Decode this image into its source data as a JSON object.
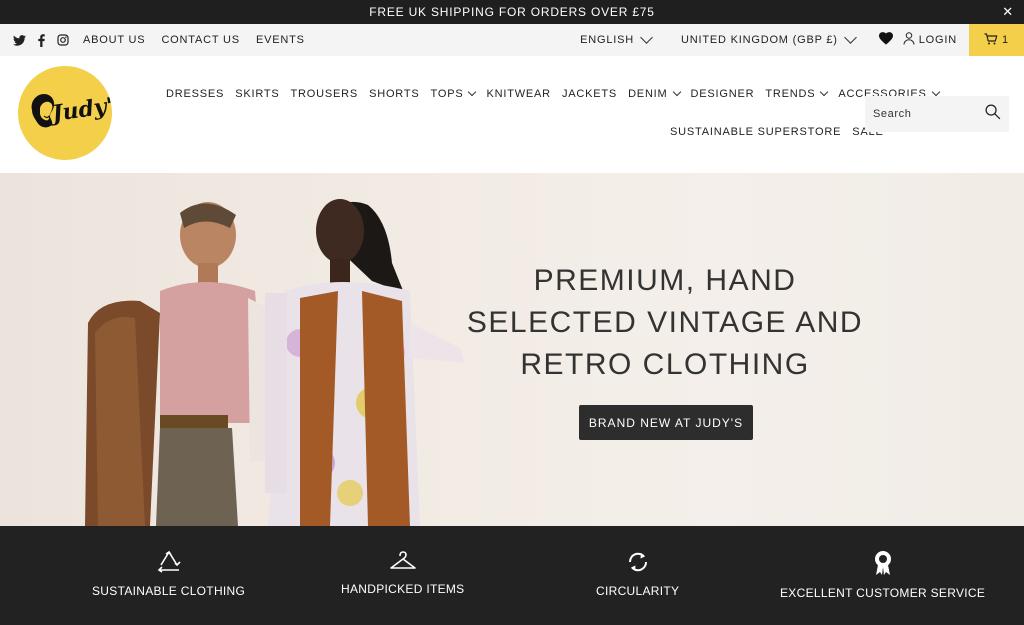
{
  "announcement": {
    "text": "FREE UK SHIPPING FOR ORDERS OVER £75",
    "close_icon": "✕"
  },
  "utility": {
    "social_icons": [
      "twitter-icon",
      "facebook-icon",
      "instagram-icon"
    ],
    "links": [
      "ABOUT US",
      "CONTACT US",
      "EVENTS"
    ],
    "language": "ENGLISH",
    "country": "UNITED KINGDOM (GBP £)",
    "login": "LOGIN",
    "cart_count": "1"
  },
  "logo": {
    "text": "Judy's"
  },
  "nav": {
    "row1": [
      {
        "label": "DRESSES",
        "dropdown": false
      },
      {
        "label": "SKIRTS",
        "dropdown": false
      },
      {
        "label": "TROUSERS",
        "dropdown": false
      },
      {
        "label": "SHORTS",
        "dropdown": false
      },
      {
        "label": "TOPS",
        "dropdown": true
      },
      {
        "label": "KNITWEAR",
        "dropdown": false
      },
      {
        "label": "JACKETS",
        "dropdown": false
      },
      {
        "label": "DENIM",
        "dropdown": true
      },
      {
        "label": "DESIGNER",
        "dropdown": false
      },
      {
        "label": "TRENDS",
        "dropdown": true
      },
      {
        "label": "ACCESSORIES",
        "dropdown": true
      }
    ],
    "row2": [
      {
        "label": "SUSTAINABLE SUPERSTORE",
        "dropdown": false
      },
      {
        "label": "SALE",
        "dropdown": false
      }
    ]
  },
  "search": {
    "placeholder": "Search"
  },
  "hero": {
    "title_lines": [
      "PREMIUM, HAND",
      "SELECTED VINTAGE AND",
      "RETRO CLOTHING"
    ],
    "button": "BRAND NEW AT JUDY'S"
  },
  "features": [
    {
      "icon": "recycle-icon",
      "label": "SUSTAINABLE CLOTHING"
    },
    {
      "icon": "hanger-icon",
      "label": "HANDPICKED ITEMS"
    },
    {
      "icon": "circular-arrows-icon",
      "label": "CIRCULARITY"
    },
    {
      "icon": "award-rosette-icon",
      "label": "EXCELLENT CUSTOMER SERVICE"
    }
  ],
  "colors": {
    "accent_yellow": "#f3cf4a",
    "dark": "#222222",
    "button": "#2d2d2d"
  }
}
